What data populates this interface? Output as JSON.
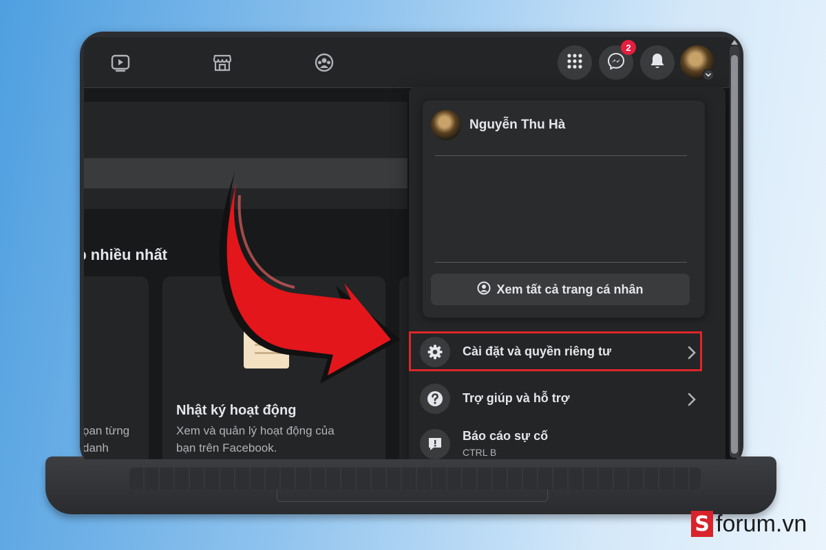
{
  "topbar": {
    "nav_icons": [
      "watch-icon",
      "marketplace-icon",
      "groups-icon"
    ],
    "messenger_badge": "2"
  },
  "page": {
    "section_title": "ập nhiều nhất",
    "left_card_desc": [
      "ọan từng",
      "danh"
    ],
    "activity_card": {
      "title": "Nhật ký hoạt động",
      "desc": [
        "Xem và quản lý hoạt động của",
        "bạn trên Facebook."
      ]
    }
  },
  "menu": {
    "profile_name": "Nguyễn Thu Hà",
    "see_all_profiles": "Xem tất cả trang cá nhân",
    "items": [
      {
        "label": "Cài đặt và quyền riêng tư",
        "icon": "gear-icon"
      },
      {
        "label": "Trợ giúp và hỗ trợ",
        "icon": "help-icon"
      },
      {
        "label": "Báo cáo sự cố",
        "sub": "CTRL B",
        "icon": "report-icon"
      }
    ]
  },
  "colors": {
    "highlight": "#e0252a",
    "arrow": "#e3161b",
    "badge": "#e41e3f"
  },
  "watermark": {
    "mark": "S",
    "text": "forum.vn"
  }
}
